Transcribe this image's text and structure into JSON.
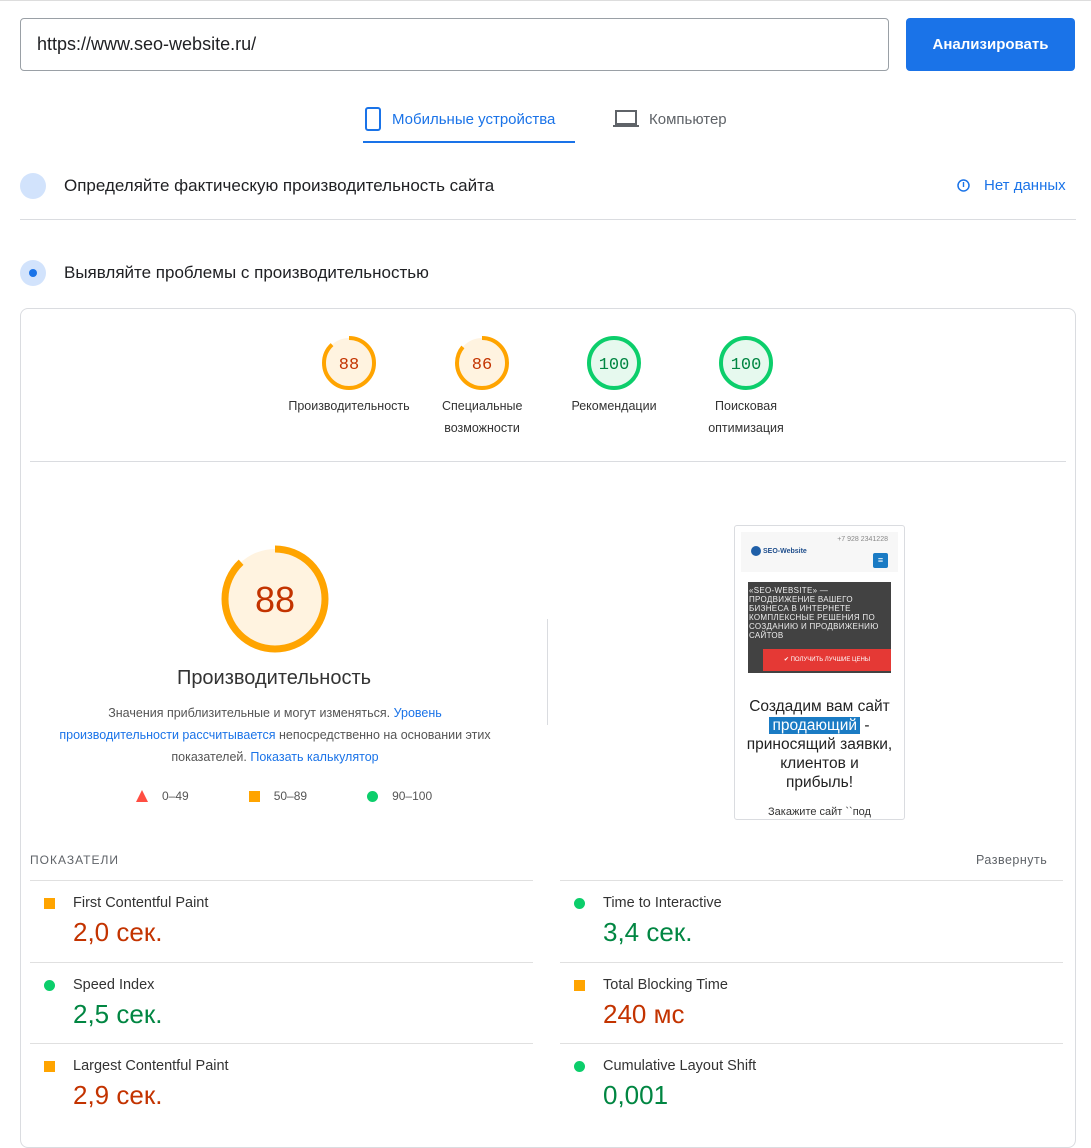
{
  "search": {
    "url": "https://www.seo-website.ru/",
    "analyze_label": "Анализировать"
  },
  "tabs": [
    {
      "label": "Мобильные устройства",
      "active": true
    },
    {
      "label": "Компьютер",
      "active": false
    }
  ],
  "field_section": {
    "title": "Определяйте фактическую производительность сайта",
    "status": "Нет данных"
  },
  "lab_section": {
    "title": "Выявляйте проблемы с производительностью"
  },
  "gauges": [
    {
      "score": 88,
      "label": "Производительность",
      "color": "#ffa400",
      "text_color": "#c33300",
      "bg": "#fff3e0"
    },
    {
      "score": 86,
      "label": "Специальные возможности",
      "color": "#ffa400",
      "text_color": "#c33300",
      "bg": "#fff3e0"
    },
    {
      "score": 100,
      "label": "Рекомендации",
      "color": "#0cce6b",
      "text_color": "#018642",
      "bg": "#e6f9ee"
    },
    {
      "score": 100,
      "label": "Поисковая оптимизация",
      "color": "#0cce6b",
      "text_color": "#018642",
      "bg": "#e6f9ee"
    }
  ],
  "main": {
    "score": 88,
    "title": "Производительность",
    "desc_1": "Значения приблизительные и могут изменяться. ",
    "desc_link_1": "Уровень производительности рассчитывается",
    "desc_2": " непосредственно на основании этих показателей. ",
    "desc_link_2": "Показать калькулятор",
    "legend": [
      "0–49",
      "50–89",
      "90–100"
    ]
  },
  "screenshot": {
    "phone": "+7 928 2341228",
    "logo": "SEO-Website",
    "hero": "«SEO-WEBSITE» — ПРОДВИЖЕНИЕ ВАШЕГО БИЗНЕСА В ИНТЕРНЕТЕ КОМПЛЕКСНЫЕ РЕШЕНИЯ ПО СОЗДАНИЮ И ПРОДВИЖЕНИЮ САЙТОВ",
    "cta": "ПОЛУЧИТЬ ЛУЧШИЕ ЦЕНЫ",
    "headline_1": "Создадим вам сайт",
    "headline_hl": "продающий",
    "headline_2": " - приносящий заявки, клиентов и прибыль!",
    "cut": "Закажите сайт ``под"
  },
  "metrics": {
    "header": "ПОКАЗАТЕЛИ",
    "expand": "Развернуть",
    "items": [
      {
        "name": "First Contentful Paint",
        "value": "2,0 сек.",
        "status": "average"
      },
      {
        "name": "Time to Interactive",
        "value": "3,4 сек.",
        "status": "pass"
      },
      {
        "name": "Speed Index",
        "value": "2,5 сек.",
        "status": "pass"
      },
      {
        "name": "Total Blocking Time",
        "value": "240 мс",
        "status": "average"
      },
      {
        "name": "Largest Contentful Paint",
        "value": "2,9 сек.",
        "status": "average"
      },
      {
        "name": "Cumulative Layout Shift",
        "value": "0,001",
        "status": "pass"
      }
    ]
  }
}
